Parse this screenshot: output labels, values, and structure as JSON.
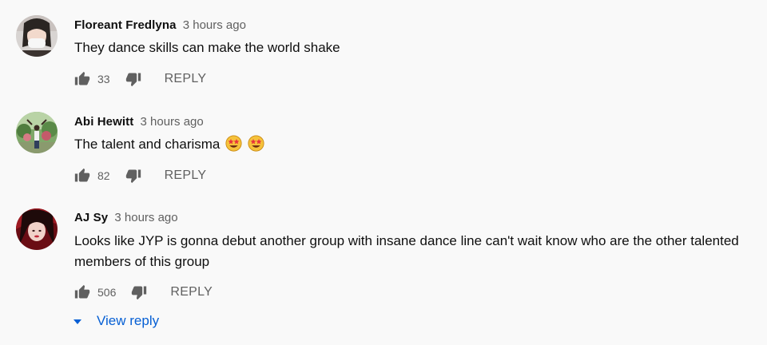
{
  "comments": [
    {
      "author": "Floreant Fredlyna",
      "time": "3 hours ago",
      "text": "They dance skills can make the world shake",
      "likes": "33",
      "reply_label": "REPLY"
    },
    {
      "author": "Abi Hewitt",
      "time": "3 hours ago",
      "text": "The talent and charisma",
      "emojis": [
        "star-struck-emoji",
        "star-struck-emoji"
      ],
      "likes": "82",
      "reply_label": "REPLY"
    },
    {
      "author": "AJ Sy",
      "time": "3 hours ago",
      "text": "Looks like JYP is gonna debut another group with insane dance line can't wait know who are the other talented members of this group",
      "likes": "506",
      "reply_label": "REPLY"
    }
  ],
  "view_reply_label": "View reply",
  "colors": {
    "background": "#f9f9f9",
    "secondary_text": "#606060",
    "link_blue": "#065fd4"
  }
}
